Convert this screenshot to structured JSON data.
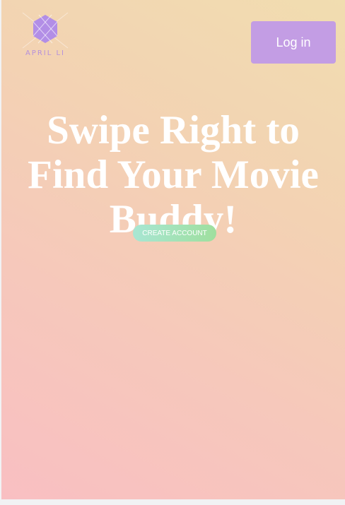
{
  "header": {
    "logo_text": "APRIL LI",
    "login_label": "Log in"
  },
  "hero": {
    "headline": "Swipe Right to Find Your Movie Buddy!",
    "cta_label": "CREATE ACCOUNT"
  },
  "colors": {
    "login_button": "#c39de4",
    "cta_start": "#a8e6d3",
    "cta_end": "#9fdf9e",
    "logo": "#b590dc",
    "headline": "#ffffff"
  },
  "icons": {
    "logo": "hexagon-logo-icon"
  }
}
